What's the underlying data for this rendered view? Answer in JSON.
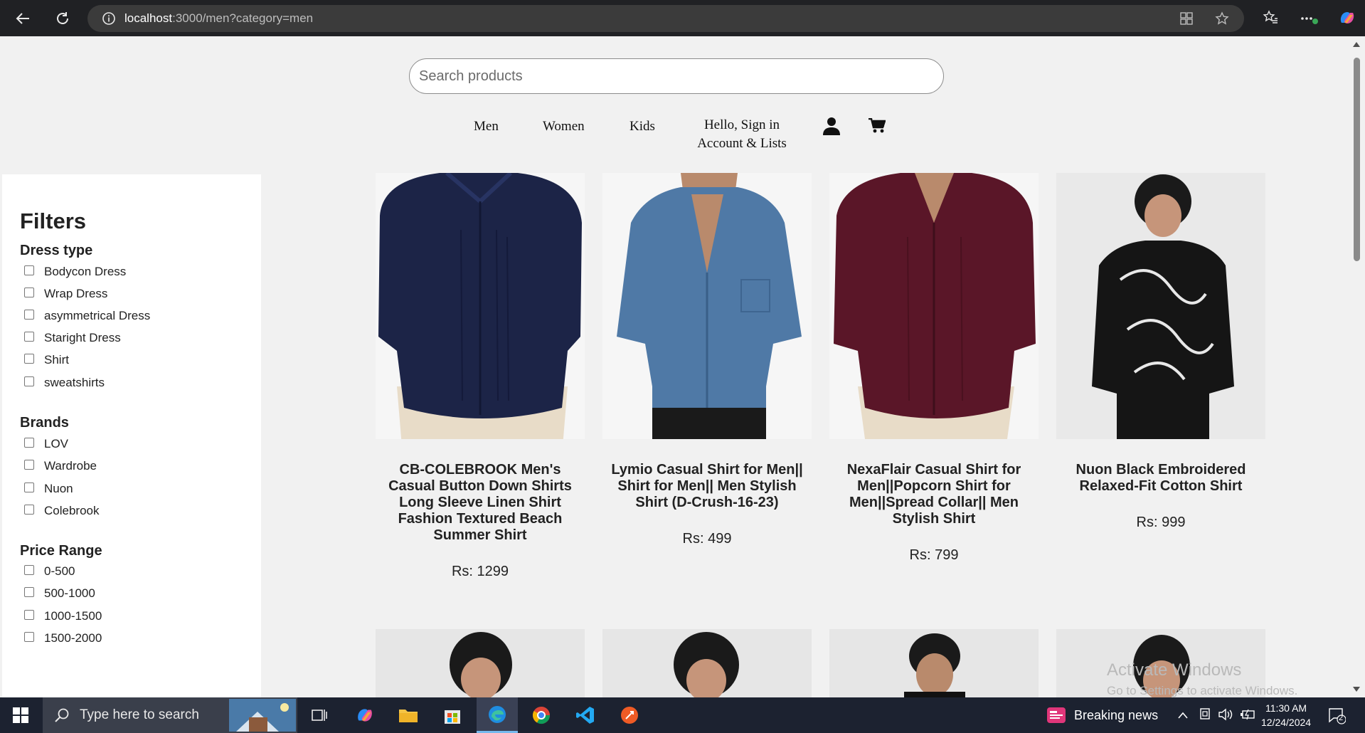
{
  "browser": {
    "url_host": "localhost",
    "url_rest": ":3000/men?category=men"
  },
  "search": {
    "placeholder": "Search products"
  },
  "nav": {
    "men": "Men",
    "women": "Women",
    "kids": "Kids",
    "signin_line1": "Hello, Sign in",
    "signin_line2": "Account & Lists"
  },
  "filters": {
    "title": "Filters",
    "groups": [
      {
        "title": "Dress type",
        "options": [
          "Bodycon Dress",
          "Wrap Dress",
          "asymmetrical Dress",
          "Staright Dress",
          "Shirt",
          "sweatshirts"
        ]
      },
      {
        "title": "Brands",
        "options": [
          "LOV",
          "Wardrobe",
          "Nuon",
          "Colebrook"
        ]
      },
      {
        "title": "Price Range",
        "options": [
          "0-500",
          "500-1000",
          "1000-1500",
          "1500-2000"
        ]
      }
    ]
  },
  "products": [
    {
      "title": "CB-COLEBROOK Men's Casual Button Down Shirts Long Sleeve Linen Shirt Fashion Textured Beach Summer Shirt",
      "price": "Rs: 1299",
      "shirt_color": "#1c2447"
    },
    {
      "title": "Lymio Casual Shirt for Men|| Shirt for Men|| Men Stylish Shirt (D-Crush-16-23)",
      "price": "Rs: 499",
      "shirt_color": "#4f79a6"
    },
    {
      "title": "NexaFlair Casual Shirt for Men||Popcorn Shirt for Men||Spread Collar|| Men Stylish Shirt",
      "price": "Rs: 799",
      "shirt_color": "#5a1628"
    },
    {
      "title": "Nuon Black Embroidered Relaxed-Fit Cotton Shirt",
      "price": "Rs: 999",
      "shirt_color": "#151515"
    }
  ],
  "watermark": {
    "line1": "Activate Windows",
    "line2": "Go to Settings to activate Windows."
  },
  "taskbar": {
    "search_text": "Type here to search",
    "news": "Breaking news",
    "time": "11:30 AM",
    "date": "12/24/2024",
    "notif_count": "2"
  }
}
